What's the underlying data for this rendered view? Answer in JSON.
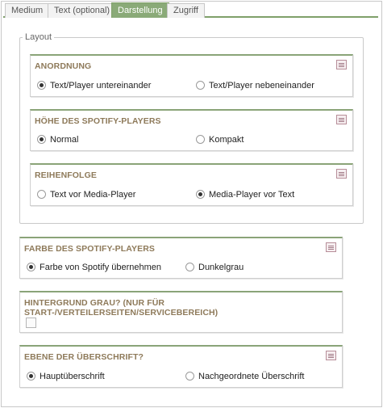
{
  "tabs": [
    {
      "label": "Medium",
      "active": false
    },
    {
      "label": "Text (optional)",
      "active": false
    },
    {
      "label": "Darstellung",
      "active": true
    },
    {
      "label": "Zugriff",
      "active": false
    }
  ],
  "layout_legend": "Layout",
  "anordnung": {
    "title": "ANORDNUNG",
    "options": [
      {
        "label": "Text/Player untereinander",
        "selected": true
      },
      {
        "label": "Text/Player nebeneinander",
        "selected": false
      }
    ]
  },
  "hoehe": {
    "title": "HÖHE DES SPOTIFY-PLAYERS",
    "options": [
      {
        "label": "Normal",
        "selected": true
      },
      {
        "label": "Kompakt",
        "selected": false
      }
    ]
  },
  "reihenfolge": {
    "title": "REIHENFOLGE",
    "options": [
      {
        "label": "Text vor Media-Player",
        "selected": false
      },
      {
        "label": "Media-Player vor Text",
        "selected": true
      }
    ]
  },
  "farbe": {
    "title": "FARBE DES SPOTIFY-PLAYERS",
    "options": [
      {
        "label": "Farbe von Spotify übernehmen",
        "selected": true
      },
      {
        "label": "Dunkelgrau",
        "selected": false
      }
    ]
  },
  "hintergrund": {
    "title": "HINTERGRUND GRAU? (NUR FÜR START-/VERTEILERSEITEN/SERVICEBEREICH)",
    "checked": false
  },
  "ebene": {
    "title": "EBENE DER ÜBERSCHRIFT?",
    "options": [
      {
        "label": "Hauptüberschrift",
        "selected": true
      },
      {
        "label": "Nachgeordnete Überschrift",
        "selected": false
      }
    ]
  },
  "colors": {
    "tab_active": "#8aaa78",
    "panel_accent": "#8aa478",
    "title_text": "#8e7a5a",
    "help_icon": "#b78e99"
  },
  "icons": {
    "help": "document-icon"
  }
}
